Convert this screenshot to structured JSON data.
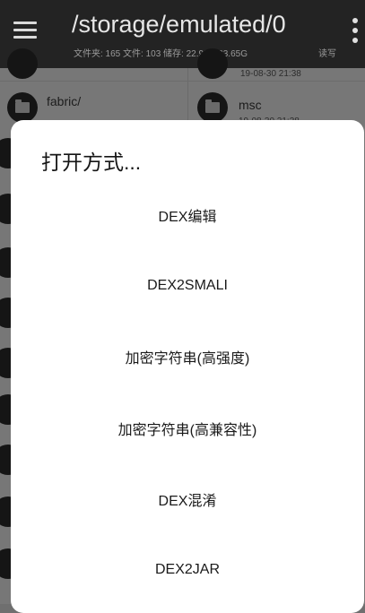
{
  "appbar": {
    "menu_icon": "hamburger-menu-icon",
    "path": "/storage/emulated/0",
    "storage_info": "文件夹: 165 文件: 103 储存: 22.99G/23.65G",
    "rw": "读写",
    "overflow_icon": "more-vertical-icon"
  },
  "files": {
    "top_right_date": "19-08-30 21:38",
    "fabric": {
      "name": "fabric/"
    },
    "msc": {
      "name": "msc",
      "date": "19-08-30 21:38"
    },
    "folder_icon": "folder-icon"
  },
  "dialog": {
    "title": "打开方式...",
    "options": [
      "DEX编辑",
      "DEX2SMALI",
      "加密字符串(高强度)",
      "加密字符串(高兼容性)",
      "DEX混淆",
      "DEX2JAR"
    ]
  },
  "colors": {
    "appbar_bg": "#232323",
    "scrim": "#777777",
    "dialog_bg": "#ffffff"
  }
}
